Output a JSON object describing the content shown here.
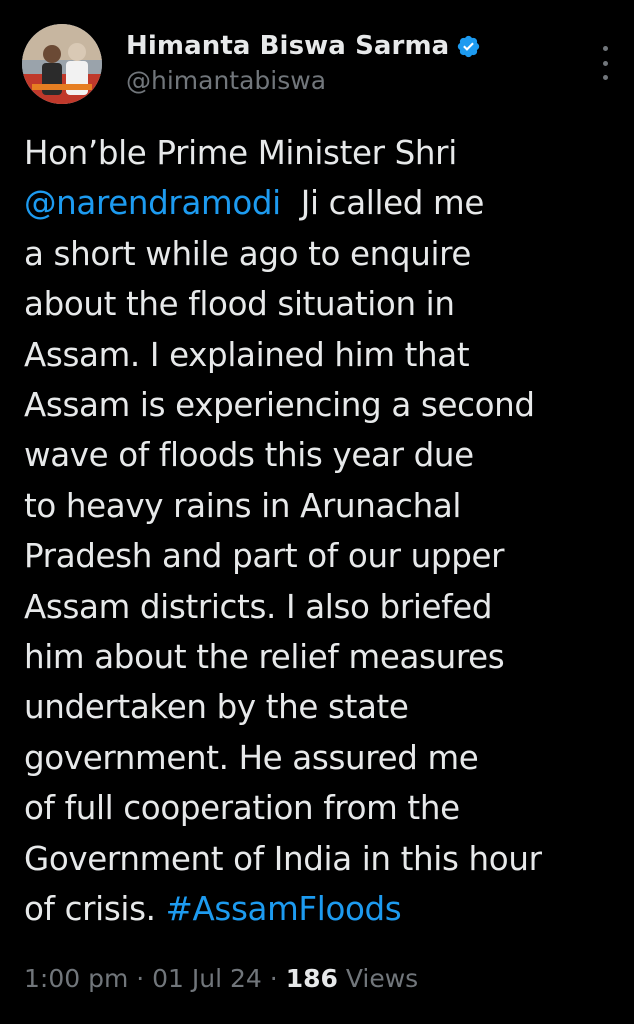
{
  "author": {
    "display_name": "Himanta Biswa Sarma",
    "handle": "@himantabiswa",
    "verified": true
  },
  "post": {
    "lines": [
      [
        {
          "text": "Hon’ble Prime Minister Shri",
          "kind": "text"
        }
      ],
      [
        {
          "text": "@narendramodi",
          "kind": "mention"
        },
        {
          "text": "  Ji called me",
          "kind": "text"
        }
      ],
      [
        {
          "text": "a short while ago to enquire",
          "kind": "text"
        }
      ],
      [
        {
          "text": "about the flood situation in",
          "kind": "text"
        }
      ],
      [
        {
          "text": "Assam. I explained him that",
          "kind": "text"
        }
      ],
      [
        {
          "text": "Assam is experiencing a second",
          "kind": "text"
        }
      ],
      [
        {
          "text": "wave of floods this year due",
          "kind": "text"
        }
      ],
      [
        {
          "text": "to heavy rains in Arunachal",
          "kind": "text"
        }
      ],
      [
        {
          "text": "Pradesh and part of our upper",
          "kind": "text"
        }
      ],
      [
        {
          "text": "Assam districts. I also briefed",
          "kind": "text"
        }
      ],
      [
        {
          "text": "him about the relief measures",
          "kind": "text"
        }
      ],
      [
        {
          "text": "undertaken by the state",
          "kind": "text"
        }
      ],
      [
        {
          "text": "government. He assured me",
          "kind": "text"
        }
      ],
      [
        {
          "text": "of full cooperation from the",
          "kind": "text"
        }
      ],
      [
        {
          "text": "Government of India in this hour",
          "kind": "text"
        }
      ],
      [
        {
          "text": "of crisis. ",
          "kind": "text"
        },
        {
          "text": "#AssamFloods",
          "kind": "hashtag"
        }
      ]
    ]
  },
  "meta": {
    "time": "1:00 pm",
    "separator": " · ",
    "date": "01 Jul 24",
    "views_count": "186",
    "views_label": " Views"
  },
  "icons": {
    "verified": "verified-badge-icon",
    "more": "more-vertical-icon"
  },
  "colors": {
    "background": "#000000",
    "text": "#e7e9ea",
    "secondary": "#71767b",
    "link": "#1d9bf0"
  }
}
